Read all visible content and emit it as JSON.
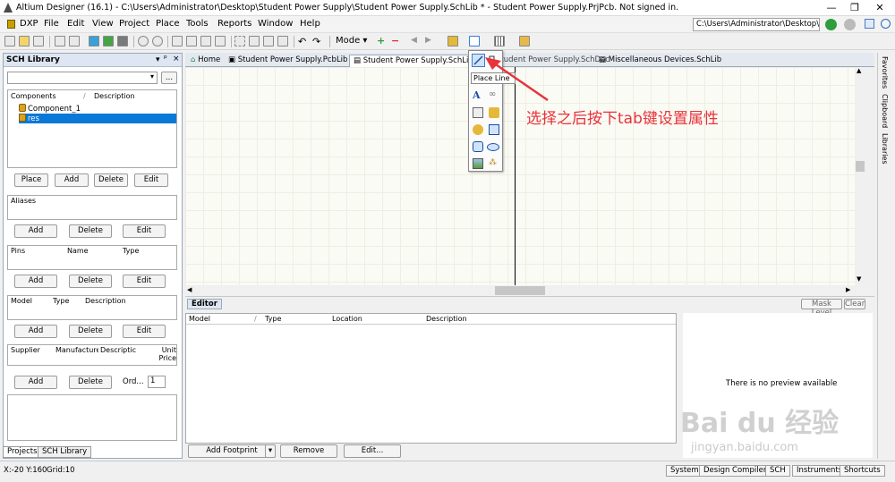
{
  "window": {
    "title": "Altium Designer (16.1) - C:\\Users\\Administrator\\Desktop\\Student Power Supply\\Student Power Supply.SchLib * - Student Power Supply.PrjPcb. Not signed in."
  },
  "menu": {
    "items": [
      "DXP",
      "File",
      "Edit",
      "View",
      "Project",
      "Place",
      "Tools",
      "Reports",
      "Window",
      "Help"
    ]
  },
  "path_box": "C:\\Users\\Administrator\\Desktop\\",
  "toolbar": {
    "mode_label": "Mode"
  },
  "left_panel": {
    "title": "SCH Library",
    "pin_icon": "ᵖ",
    "close_icon": "×",
    "browse_label": "...",
    "components_header": [
      "Components",
      "Description"
    ],
    "components": [
      "Component_1",
      "res"
    ],
    "selected_component": "res",
    "comp_buttons": [
      "Place",
      "Add",
      "Delete",
      "Edit"
    ],
    "aliases_header": "Aliases",
    "alias_buttons": [
      "Add",
      "Delete",
      "Edit"
    ],
    "pins_header": [
      "Pins",
      "Name",
      "Type"
    ],
    "pin_buttons": [
      "Add",
      "Delete",
      "Edit"
    ],
    "model_header": [
      "Model",
      "Type",
      "Description"
    ],
    "model_buttons": [
      "Add",
      "Delete",
      "Edit"
    ],
    "supplier_header": [
      "Supplier",
      "Manufacture",
      "Descriptic",
      "Unit Price"
    ],
    "supplier_buttons": [
      "Add",
      "Delete"
    ],
    "order_label": "Ord...",
    "order_value": "1",
    "bottom_tabs": [
      "Projects",
      "SCH Library"
    ]
  },
  "tabs": [
    {
      "label": "Home"
    },
    {
      "label": "Student Power Supply.PcbLib *"
    },
    {
      "label": "Student Power Supply.SchLib *"
    },
    {
      "label": "Student Power Supply.SchDoc"
    },
    {
      "label": "Miscellaneous Devices.SchLib"
    }
  ],
  "editor": {
    "tab_label": "Editor",
    "mask_level": "Mask Level",
    "clear": "Clear",
    "columns": [
      "Model",
      "Type",
      "Location",
      "Description"
    ],
    "preview_text": "There is no preview available",
    "buttons": {
      "add_footprint": "Add Footprint",
      "remove": "Remove",
      "edit": "Edit..."
    }
  },
  "right_bar": [
    "Favorites",
    "Clipboard",
    "Libraries"
  ],
  "status": {
    "coords": "X:-20 Y:160",
    "grid": "Grid:10",
    "buttons": [
      "System",
      "Design Compiler",
      "SCH",
      "Instruments",
      "Shortcuts"
    ]
  },
  "dropdown": {
    "tooltip": "Place Line"
  },
  "annotation": "选择之后按下tab键设置属性",
  "watermark": "Bai du 经验",
  "watermark_url": "jingyan.baidu.com",
  "colors": {
    "accent": "#0a78d7",
    "annotation": "#e8333b"
  }
}
